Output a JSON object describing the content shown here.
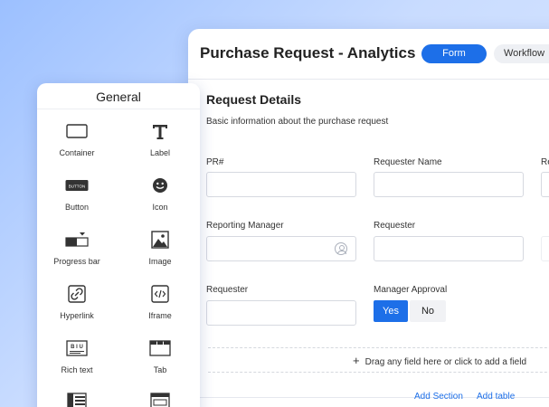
{
  "window": {
    "title": "Purchase Request - Analytics",
    "tabs": [
      {
        "label": "Form",
        "active": true
      },
      {
        "label": "Workflow",
        "active": false
      }
    ]
  },
  "section": {
    "title": "Request Details",
    "subtitle": "Basic information about the purchase request"
  },
  "fields": {
    "pr_number": {
      "label": "PR#",
      "value": ""
    },
    "requester_name": {
      "label": "Requester Name",
      "value": ""
    },
    "third_col": {
      "label": "Re",
      "value": ""
    },
    "reporting_manager": {
      "label": "Reporting Manager",
      "value": ""
    },
    "requester_1": {
      "label": "Requester",
      "value": ""
    },
    "requester_2": {
      "label": "Requester",
      "value": ""
    },
    "manager_approval": {
      "label": "Manager Approval",
      "yes": "Yes",
      "no": "No"
    }
  },
  "dropzone": {
    "text": "Drag any field here or click to add a field"
  },
  "actions": {
    "add_section": "Add Section",
    "add_table": "Add table"
  },
  "palette": {
    "title": "General",
    "items": [
      {
        "label": "Container",
        "icon": "container-icon"
      },
      {
        "label": "Label",
        "icon": "label-icon"
      },
      {
        "label": "Button",
        "icon": "button-icon"
      },
      {
        "label": "Icon",
        "icon": "smiley-icon"
      },
      {
        "label": "Progress bar",
        "icon": "progress-bar-icon"
      },
      {
        "label": "Image",
        "icon": "image-icon"
      },
      {
        "label": "Hyperlink",
        "icon": "link-icon"
      },
      {
        "label": "Iframe",
        "icon": "code-icon"
      },
      {
        "label": "Rich text",
        "icon": "rich-text-icon"
      },
      {
        "label": "Tab",
        "icon": "tab-icon"
      }
    ],
    "button_icon_text": "BUTTON",
    "richtext_icon_text": "B I U"
  },
  "colors": {
    "accent": "#1d6fe8",
    "border": "#d6d9e0"
  }
}
